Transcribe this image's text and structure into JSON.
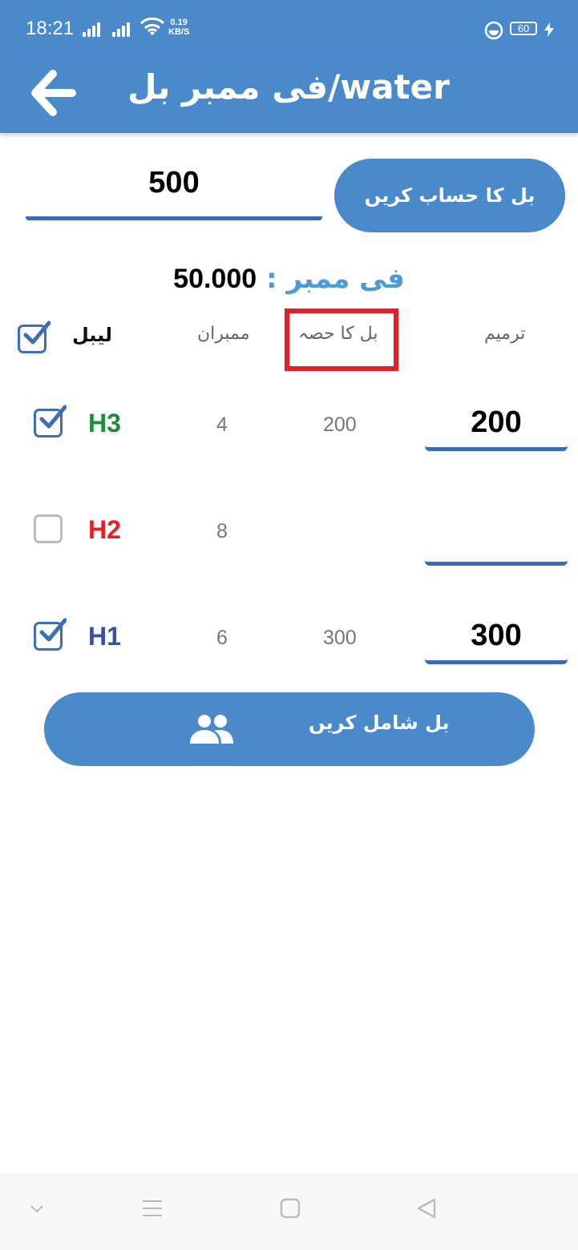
{
  "status_bar": {
    "time": "18:21",
    "net_speed_value": "0.19",
    "net_speed_unit": "KB/S",
    "battery": "60"
  },
  "app_bar": {
    "title": "فی ممبر بل/water"
  },
  "bill": {
    "total_value": "500",
    "calculate_button_label": "بل کا حساب کریں"
  },
  "per_member": {
    "label": "فی ممبر",
    "colon": ":",
    "value": "50.000"
  },
  "table": {
    "headers": {
      "label": "لیبل",
      "members": "ممبران",
      "bill_share": "بل کا حصہ",
      "adjustment": "ترمیم"
    },
    "rows": [
      {
        "label": "H3",
        "label_color": "#1e8a3a",
        "checked": true,
        "members": "4",
        "share": "200",
        "adjustment": "200"
      },
      {
        "label": "H2",
        "label_color": "#e3202a",
        "checked": false,
        "members": "8",
        "share": "",
        "adjustment": ""
      },
      {
        "label": "H1",
        "label_color": "#3b4fa0",
        "checked": true,
        "members": "6",
        "share": "300",
        "adjustment": "300"
      }
    ]
  },
  "add_bill_button_label": "بل شامل کریں",
  "colors": {
    "primary": "#4a8acb",
    "accent_underline": "#3a6cb5",
    "highlight": "#e3202a"
  }
}
